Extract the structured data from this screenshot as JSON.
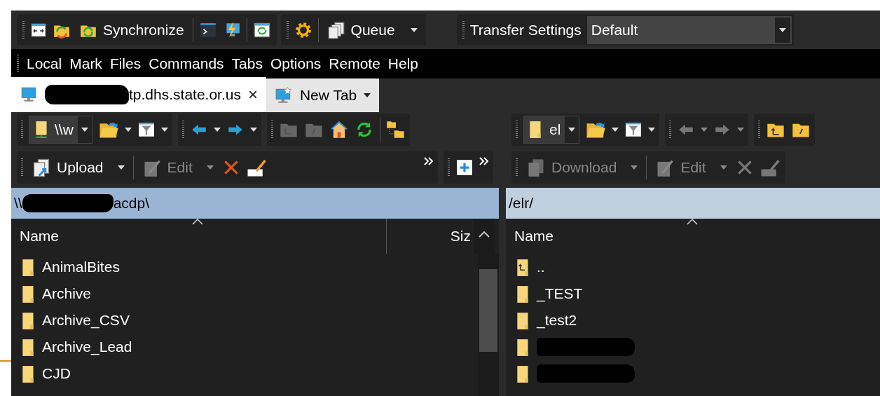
{
  "toolbar": {
    "synchronize": "Synchronize",
    "queue": "Queue",
    "transfer_settings_label": "Transfer Settings",
    "transfer_settings_value": "Default"
  },
  "menu": [
    "Local",
    "Mark",
    "Files",
    "Commands",
    "Tabs",
    "Options",
    "Remote",
    "Help"
  ],
  "tabs": [
    {
      "label": "tp.dhs.state.or.us",
      "selected": true,
      "redacted": true,
      "close": "×"
    },
    {
      "label": "New Tab",
      "selected": false,
      "redacted": false
    }
  ],
  "local_panel": {
    "drive": "\\\\w",
    "upload": {
      "label": "Upload",
      "disabled": false
    },
    "edit": {
      "label": "Edit",
      "disabled": true
    },
    "back_disabled": false,
    "path_start": "\\\\",
    "path_end": "acdp\\",
    "columns": [
      "Name",
      "Siz"
    ],
    "files": [
      {
        "name": "AnimalBites",
        "kind": "folder"
      },
      {
        "name": "Archive",
        "kind": "folder"
      },
      {
        "name": "Archive_CSV",
        "kind": "folder"
      },
      {
        "name": "Archive_Lead",
        "kind": "folder"
      },
      {
        "name": "CJD",
        "kind": "folder"
      }
    ]
  },
  "remote_panel": {
    "drive": "el",
    "download": {
      "label": "Download",
      "disabled": true
    },
    "edit": {
      "label": "Edit",
      "disabled": true
    },
    "back_disabled": true,
    "path": "/elr/",
    "columns": [
      "Name"
    ],
    "files": [
      {
        "name": "..",
        "kind": "parent"
      },
      {
        "name": "_TEST",
        "kind": "folder"
      },
      {
        "name": "_test2",
        "kind": "folder"
      },
      {
        "kind": "redacted"
      },
      {
        "kind": "redacted"
      }
    ]
  }
}
